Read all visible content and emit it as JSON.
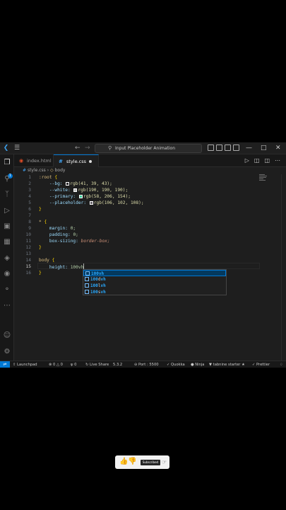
{
  "window": {
    "search_text": "Input Placeholder Animation",
    "logo": "vscode-logo"
  },
  "tabs": [
    {
      "label": "index.html",
      "icon": "html5-icon",
      "active": false
    },
    {
      "label": "style.css",
      "icon": "css-icon",
      "active": true,
      "modified": true
    }
  ],
  "breadcrumb": {
    "file": "style.css",
    "symbol": "body"
  },
  "activity_bar": {
    "badge": "1"
  },
  "editor": {
    "line_numbers": [
      "1",
      "2",
      "3",
      "4",
      "5",
      "6",
      "7",
      "8",
      "9",
      "10",
      "11",
      "12",
      "13",
      "14",
      "15",
      "16"
    ],
    "active_line": "15",
    "lines": {
      "l1_sel": ":root",
      "l1_open": " {",
      "l2_prop": "--bg:",
      "l2_val": "rgb(41, 39, 43);",
      "l3_prop": "--white:",
      "l3_val": "rgb(190, 190, 190);",
      "l4_prop": "--primary:",
      "l4_val": "rgb(58, 206, 154);",
      "l5_prop": "--placeholder:",
      "l5_val": "rgb(106, 102, 108);",
      "l6": "}",
      "l8_sel": "*",
      "l8_open": " {",
      "l9_prop": "margin:",
      "l9_val": " 0;",
      "l10_prop": "padding:",
      "l10_val": " 0;",
      "l11_prop": "box-sizing:",
      "l11_val": " border-box;",
      "l12": "}",
      "l14_sel": "body",
      "l14_open": " {",
      "l15_prop": "height:",
      "l15_val": " 100vh",
      "l16": "}"
    }
  },
  "colors": {
    "swatch_bg": "#29272b",
    "swatch_white": "#bebebe",
    "swatch_primary": "#3ace9a",
    "swatch_placeholder": "#6a666c",
    "accent": "#0078d4"
  },
  "suggestions": [
    {
      "match": "100vh",
      "rest": "",
      "selected": true
    },
    {
      "match": "100",
      "mid": "d",
      "rest": "vh",
      "selected": false
    },
    {
      "match": "100",
      "mid": "l",
      "rest": "vh",
      "selected": false
    },
    {
      "match": "100",
      "mid": "s",
      "rest": "vh",
      "selected": false
    }
  ],
  "statusbar": {
    "launchpad": "Launchpad",
    "errors": "0",
    "warnings": "0",
    "ports": "0",
    "live_share": "Live Share",
    "version": "5.3.2",
    "port": "Port : 5500",
    "quokka": "Quokka",
    "ninja": "Ninja",
    "tabnine": "tabnine starter",
    "prettier": "Prettier"
  },
  "overlay": {
    "subscribe": "Subscribed"
  }
}
